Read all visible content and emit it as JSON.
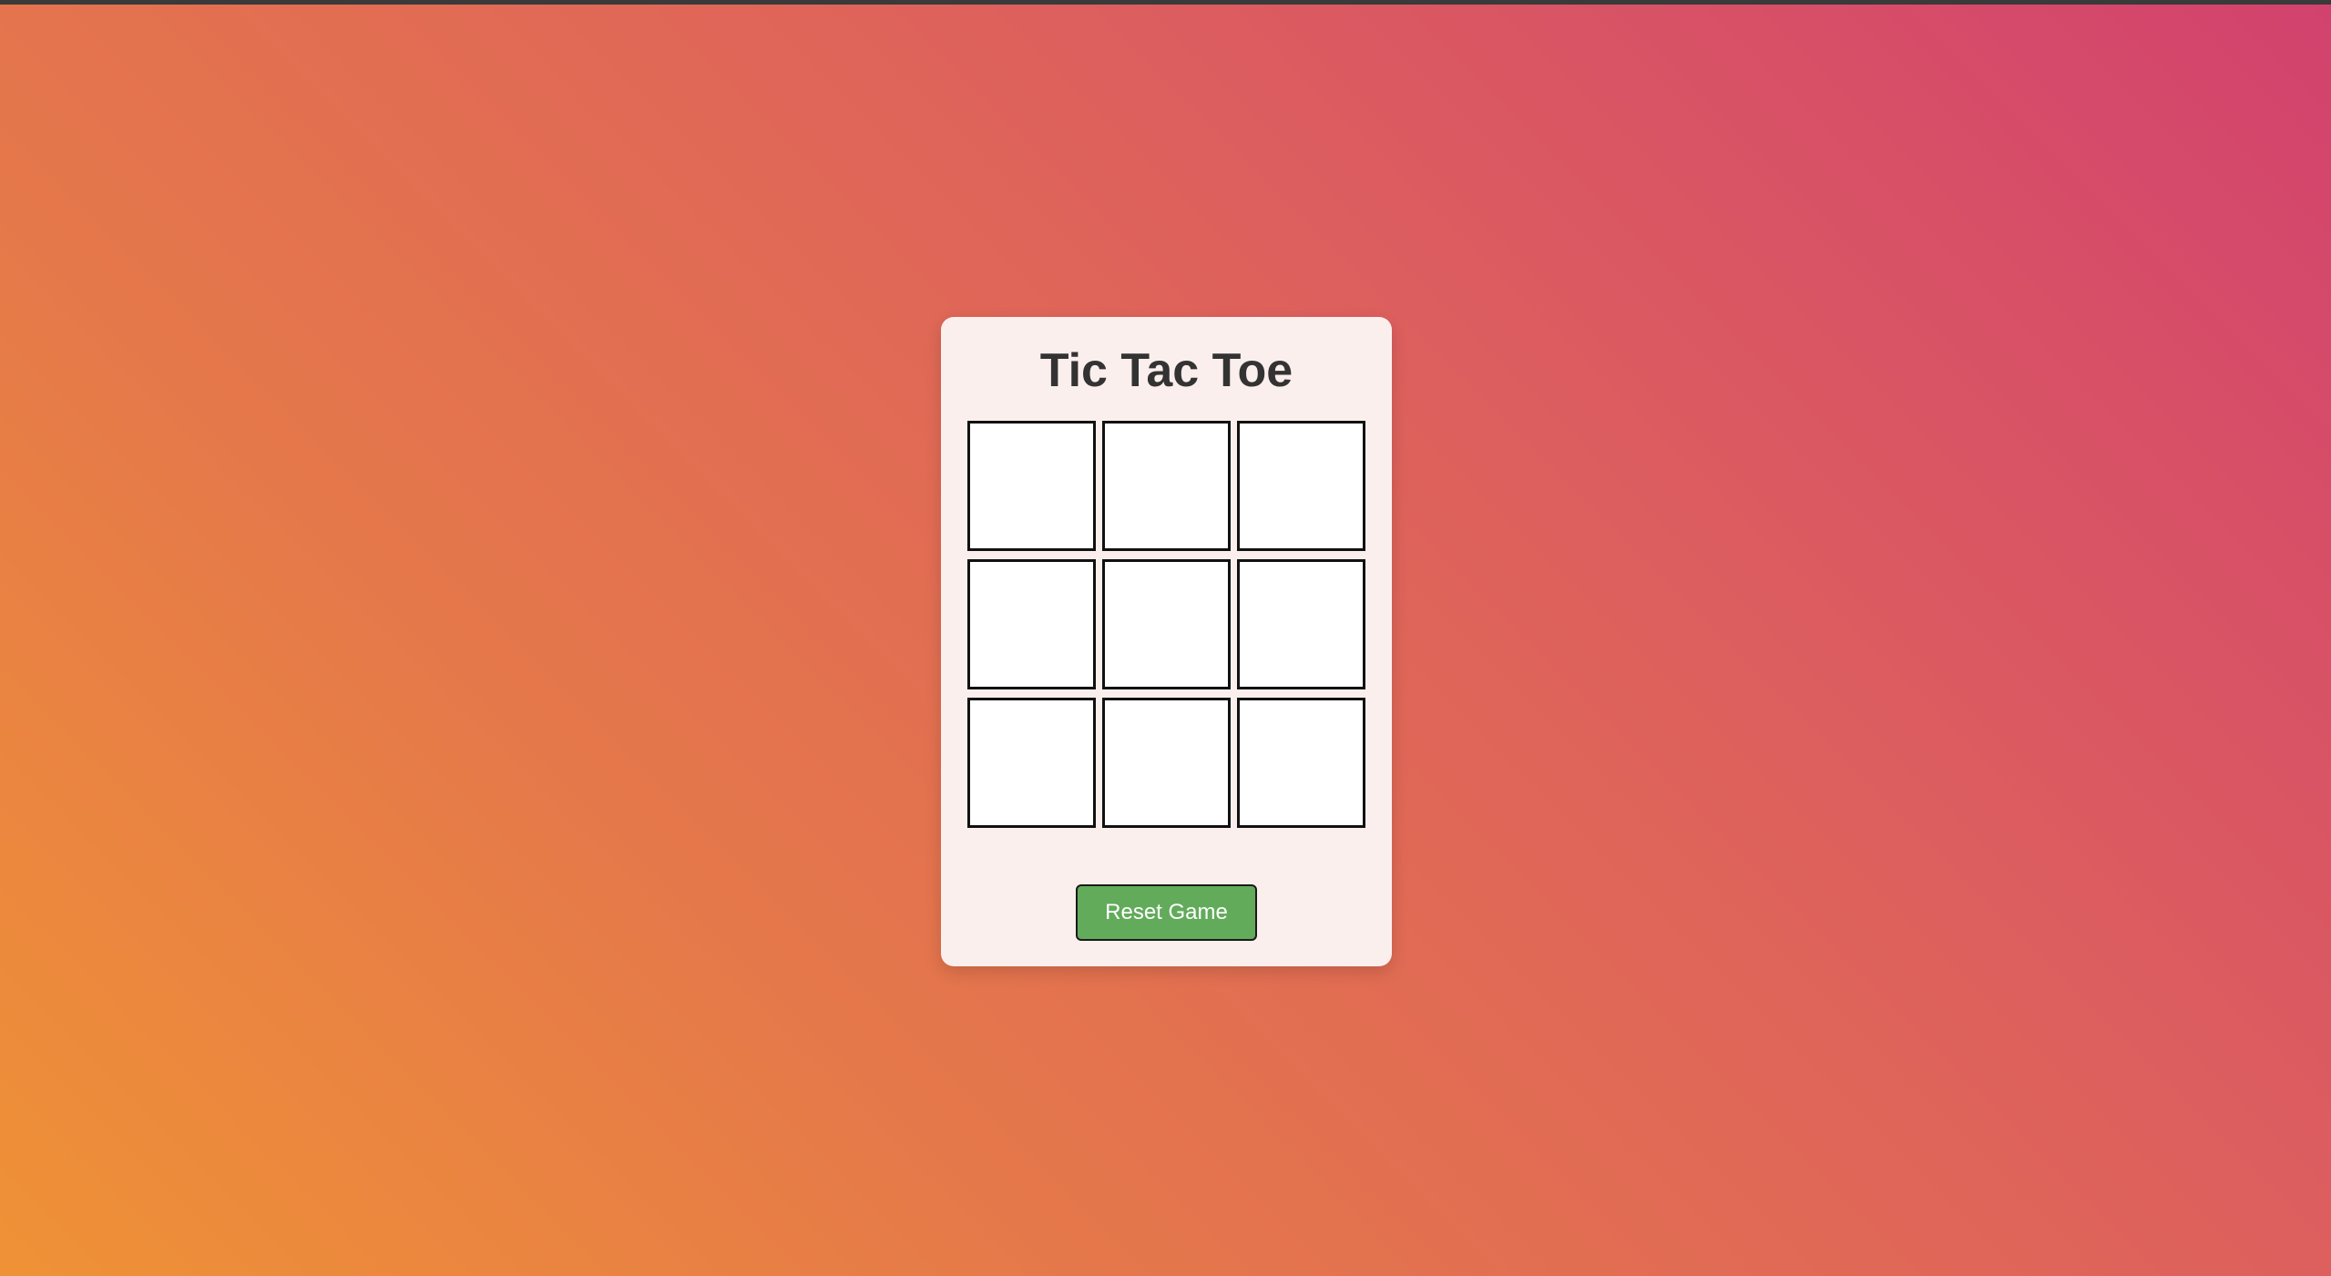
{
  "game": {
    "title": "Tic Tac Toe",
    "board": [
      "",
      "",
      "",
      "",
      "",
      "",
      "",
      "",
      ""
    ],
    "reset_label": "Reset Game"
  },
  "colors": {
    "card_background": "#fbefed",
    "reset_button": "#62ab5b",
    "gradient_start": "#ef9236",
    "gradient_end": "#d2426e"
  }
}
